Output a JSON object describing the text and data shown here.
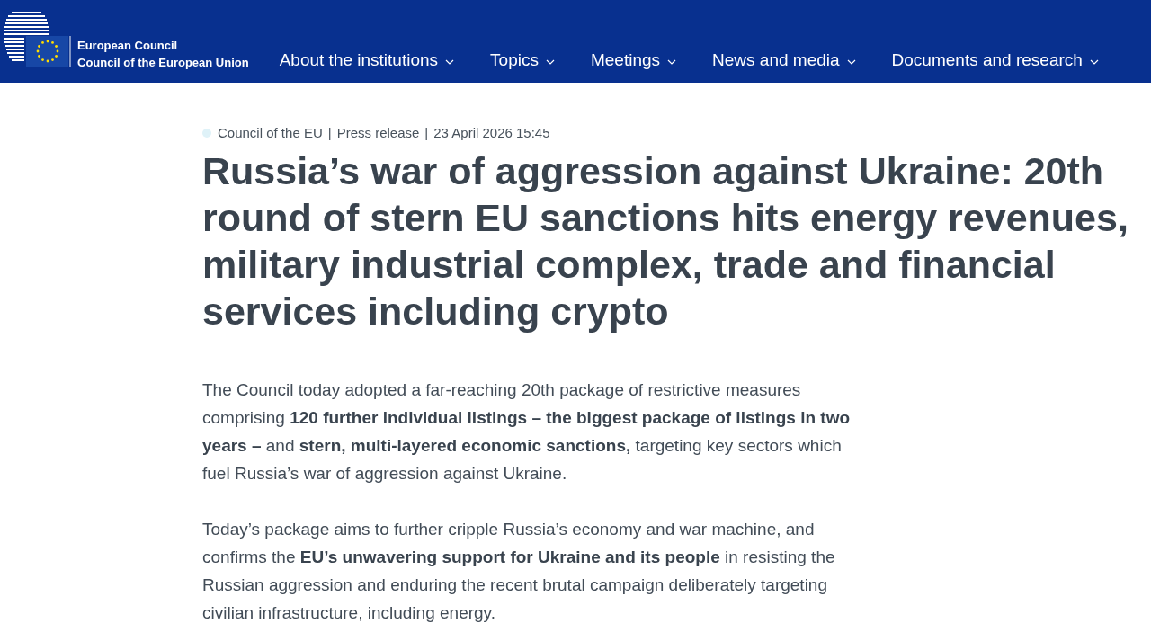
{
  "header": {
    "logo": {
      "line1": "European Council",
      "line2": "Council of the European Union"
    },
    "nav": [
      {
        "label": "About the institutions"
      },
      {
        "label": "Topics"
      },
      {
        "label": "Meetings"
      },
      {
        "label": "News and media"
      },
      {
        "label": "Documents and research"
      }
    ]
  },
  "article": {
    "meta": {
      "items": [
        "Council of the EU",
        "Press release",
        "23 April 2026 15:45"
      ],
      "separator": "|"
    },
    "title": "Russia’s war of aggression against Ukraine: 20th round of stern EU sanctions hits energy revenues, military industrial complex, trade and financial services including crypto",
    "paragraphs": [
      "The Council today adopted a far-reaching 20th package of restrictive measures comprising **120 further individual listings – the biggest package of listings in two years –** and **stern, multi-layered economic sanctions,** targeting key sectors which fuel Russia’s war of aggression against Ukraine.",
      "Today’s package aims to further cripple Russia’s economy and war machine, and confirms the **EU’s unwavering support for Ukraine and its people** in resisting the Russian aggression and enduring the recent brutal campaign deliberately targeting civilian infrastructure, including energy."
    ]
  }
}
